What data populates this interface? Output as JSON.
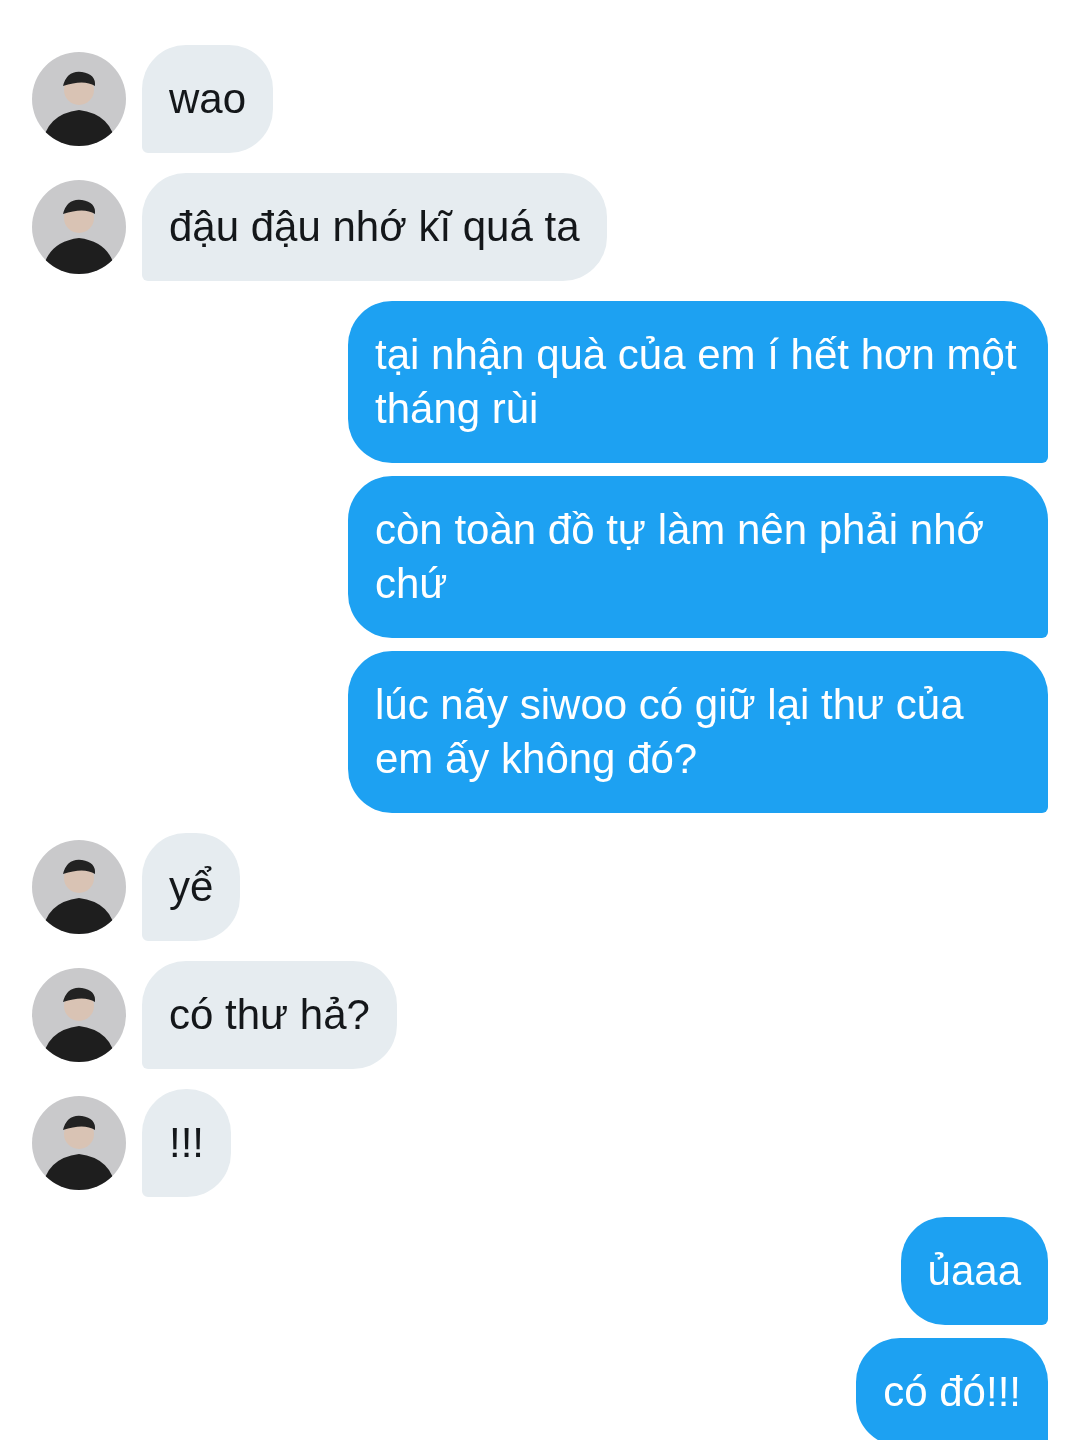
{
  "messages": [
    {
      "kind": "received",
      "text": "wao"
    },
    {
      "kind": "received",
      "text": "đậu đậu nhớ kĩ quá ta"
    },
    {
      "kind": "sent",
      "text": "tại nhận quà của em í hết hơn một tháng rùi"
    },
    {
      "kind": "sent",
      "text": "còn toàn đồ tự làm nên phải nhớ chứ"
    },
    {
      "kind": "sent",
      "text": "lúc nãy siwoo có giữ lại thư của em ấy không đó?"
    },
    {
      "kind": "received",
      "text": "yể"
    },
    {
      "kind": "received",
      "text": "có thư hả?"
    },
    {
      "kind": "received",
      "text": "!!!"
    },
    {
      "kind": "sent",
      "text": "ủaaa"
    },
    {
      "kind": "sent",
      "text": "có đó!!!"
    }
  ]
}
